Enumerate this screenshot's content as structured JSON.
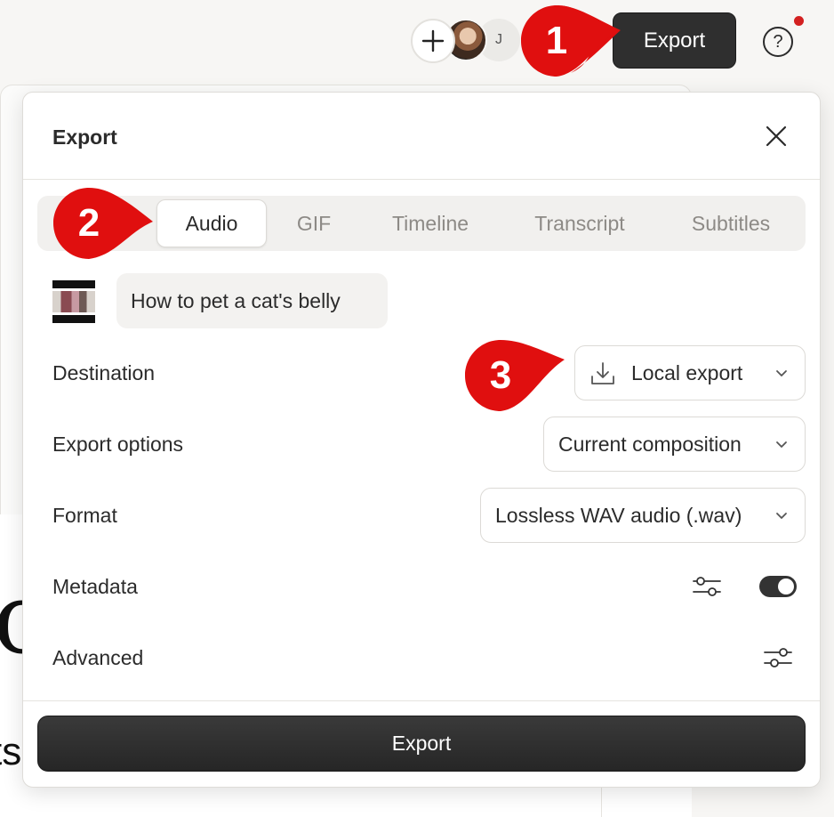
{
  "topbar": {
    "avatar_initial": "J",
    "export_label": "Export",
    "help_label": "?"
  },
  "background": {
    "glyph_top": "c]",
    "glyph_bottom": "ts"
  },
  "dialog": {
    "title": "Export",
    "tabs": [
      {
        "label": "Audio",
        "active": true
      },
      {
        "label": "GIF",
        "active": false
      },
      {
        "label": "Timeline",
        "active": false
      },
      {
        "label": "Transcript",
        "active": false
      },
      {
        "label": "Subtitles",
        "active": false
      }
    ],
    "composition_title": "How to pet a cat's belly",
    "rows": {
      "destination": {
        "label": "Destination",
        "value": "Local export"
      },
      "export_options": {
        "label": "Export options",
        "value": "Current composition"
      },
      "format": {
        "label": "Format",
        "value": "Lossless WAV audio (.wav)"
      },
      "metadata": {
        "label": "Metadata",
        "toggle_on": true
      },
      "advanced": {
        "label": "Advanced"
      }
    },
    "export_button": "Export"
  },
  "callouts": [
    "1",
    "2",
    "3"
  ],
  "colors": {
    "callout_red": "#e00f0f",
    "dark_button": "#2f2f2f",
    "notification_dot": "#d32020"
  }
}
